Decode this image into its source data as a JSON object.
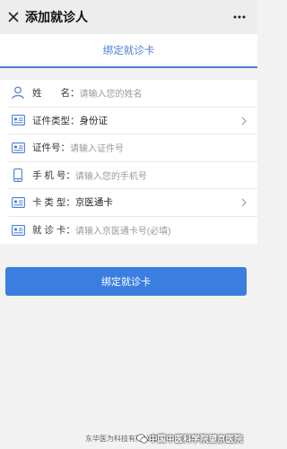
{
  "nav": {
    "title": "添加就诊人"
  },
  "header": {
    "title": "绑定就诊卡"
  },
  "form": {
    "name": {
      "label": "姓　　名：",
      "placeholder": "请输入您的姓名",
      "icon": "person-icon"
    },
    "id_type": {
      "label": "证件类型：",
      "value": "身份证",
      "icon": "id-card-icon"
    },
    "id_number": {
      "label": "证件号：",
      "placeholder": "请输入证件号",
      "icon": "id-card-icon"
    },
    "phone": {
      "label": "手 机 号：",
      "placeholder": "请输入您的手机号",
      "icon": "phone-icon"
    },
    "card_type": {
      "label": "卡 类 型：",
      "value": "京医通卡",
      "icon": "card-icon"
    },
    "card_number": {
      "label": "就 诊 卡：",
      "placeholder": "请输入京医通卡号(必填)",
      "icon": "card-icon"
    }
  },
  "submit": {
    "label": "绑定就诊卡"
  },
  "footer": {
    "text": "东华医为科技有限公司",
    "watermark": "中国中医科学院望京医院"
  },
  "colors": {
    "accent": "#3a7fe0",
    "icon": "#4a7fd4"
  }
}
